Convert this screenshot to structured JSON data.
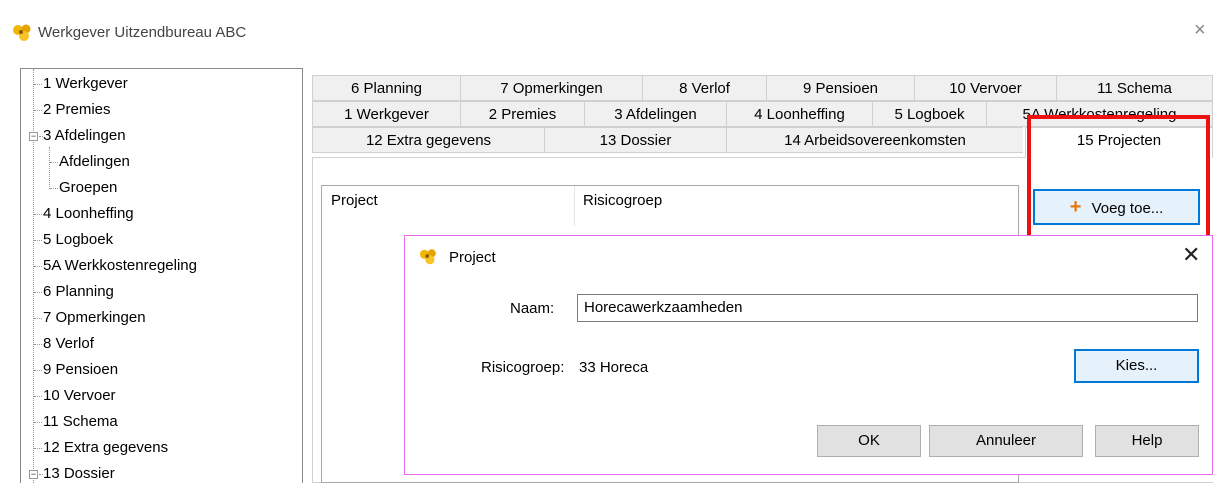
{
  "window": {
    "title": "Werkgever Uitzendbureau ABC",
    "close_glyph": "×",
    "icon": "sunflower-app-icon"
  },
  "tree": {
    "items": [
      {
        "label": "1 Werkgever"
      },
      {
        "label": "2 Premies"
      },
      {
        "label": "3 Afdelingen",
        "expanded": true
      },
      {
        "label": "Afdelingen",
        "level": 2
      },
      {
        "label": "Groepen",
        "level": 2
      },
      {
        "label": "4 Loonheffing"
      },
      {
        "label": "5 Logboek"
      },
      {
        "label": "5A Werkkostenregeling"
      },
      {
        "label": "6 Planning"
      },
      {
        "label": "7 Opmerkingen"
      },
      {
        "label": "8 Verlof"
      },
      {
        "label": "9 Pensioen"
      },
      {
        "label": "10 Vervoer"
      },
      {
        "label": "11 Schema"
      },
      {
        "label": "12 Extra gegevens"
      },
      {
        "label": "13 Dossier",
        "expanded": true
      }
    ]
  },
  "tabs": {
    "row1": [
      "6 Planning",
      "7 Opmerkingen",
      "8 Verlof",
      "9 Pensioen",
      "10 Vervoer",
      "11 Schema"
    ],
    "row2": [
      "1 Werkgever",
      "2 Premies",
      "3 Afdelingen",
      "4 Loonheffing",
      "5 Logboek",
      "5A Werkkostenregeling"
    ],
    "row3": [
      "12 Extra gegevens",
      "13 Dossier",
      "14 Arbeidsovereenkomsten",
      "15 Projecten"
    ],
    "active": "15 Projecten"
  },
  "list": {
    "columns": [
      "Project",
      "Risicogroep"
    ]
  },
  "add_button": {
    "label": "Voeg toe...",
    "icon": "plus-icon"
  },
  "highlight_color": "#ee1111",
  "dialog": {
    "title": "Project",
    "close_glyph": "✕",
    "name_label": "Naam:",
    "name_value": "Horecawerkzaamheden",
    "risk_label": "Risicogroep:",
    "risk_value": "33 Horeca",
    "choose_button": "Kies...",
    "ok_button": "OK",
    "cancel_button": "Annuleer",
    "help_button": "Help",
    "border_color": "#e66be8"
  }
}
